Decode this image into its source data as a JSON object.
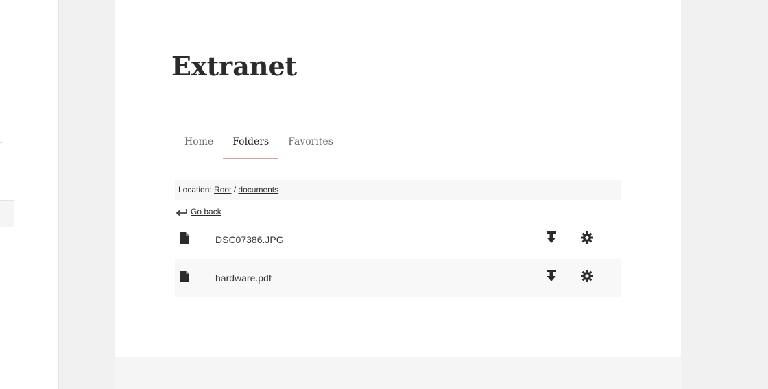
{
  "site": {
    "title": "Extranet"
  },
  "tabs": [
    {
      "label": "Home",
      "active": false
    },
    {
      "label": "Folders",
      "active": true
    },
    {
      "label": "Favorites",
      "active": false
    }
  ],
  "location": {
    "label": "Location: ",
    "separator": " / ",
    "crumbs": [
      "Root",
      "documents"
    ]
  },
  "navigation": {
    "go_back_label": "Go back"
  },
  "files": [
    {
      "name": "DSC07386.JPG",
      "icon": "file-icon"
    },
    {
      "name": "hardware.pdf",
      "icon": "file-icon"
    }
  ],
  "colors": {
    "accent_underline": "#c9a79a",
    "text": "#2b2b2b",
    "page_background": "#f1f1f1",
    "row_alt": "#f8f8f8"
  }
}
